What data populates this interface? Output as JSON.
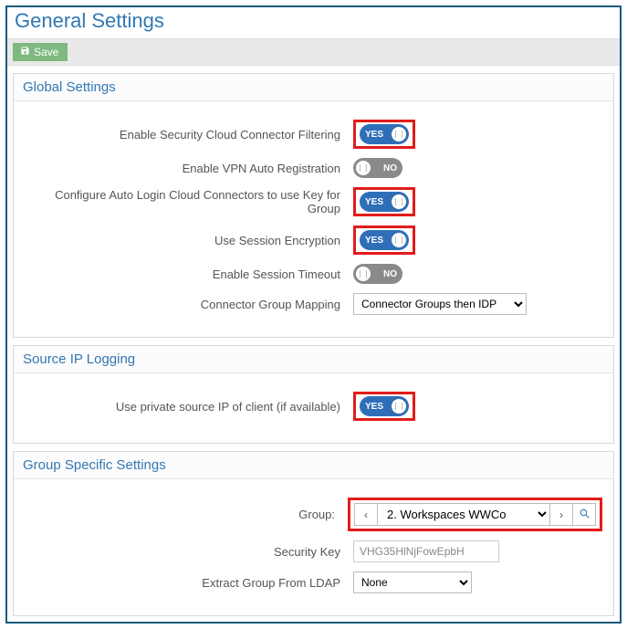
{
  "page": {
    "title": "General Settings"
  },
  "toolbar": {
    "save_label": "Save"
  },
  "toggle_labels": {
    "yes": "YES",
    "no": "NO"
  },
  "sections": {
    "global": {
      "title": "Global Settings",
      "rows": {
        "filtering": {
          "label": "Enable Security Cloud Connector Filtering",
          "value": true,
          "highlight": true
        },
        "vpn": {
          "label": "Enable VPN Auto Registration",
          "value": false,
          "highlight": false
        },
        "key_group": {
          "label": "Configure Auto Login Cloud Connectors to use Key for Group",
          "value": true,
          "highlight": true
        },
        "encryption": {
          "label": "Use Session Encryption",
          "value": true,
          "highlight": true
        },
        "timeout": {
          "label": "Enable Session Timeout",
          "value": false,
          "highlight": false
        },
        "mapping": {
          "label": "Connector Group Mapping",
          "selected": "Connector Groups then IDP"
        }
      }
    },
    "source_ip": {
      "title": "Source IP Logging",
      "rows": {
        "private_ip": {
          "label": "Use private source IP of client (if available)",
          "value": true,
          "highlight": true
        }
      }
    },
    "group": {
      "title": "Group Specific Settings",
      "rows": {
        "group": {
          "label": "Group:",
          "selected": "2. Workspaces WWCo"
        },
        "seckey": {
          "label": "Security Key",
          "value": "VHG35HlNjFowEpbH"
        },
        "ldap": {
          "label": "Extract Group From LDAP",
          "selected": "None"
        }
      }
    }
  }
}
